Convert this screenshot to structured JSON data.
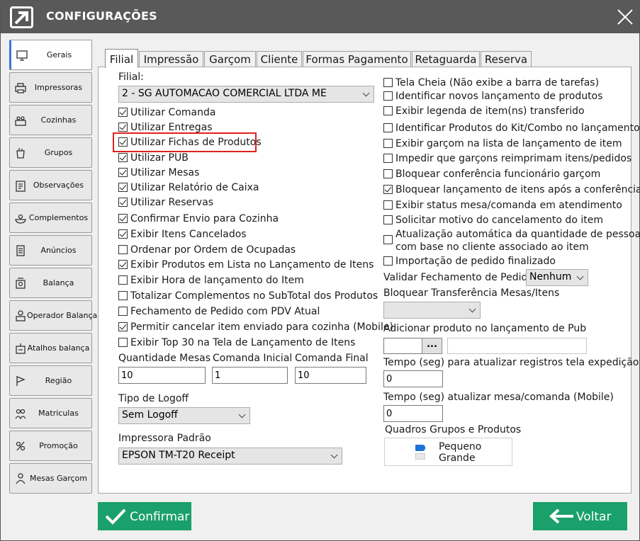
{
  "window": {
    "title": "CONFIGURAÇÕES"
  },
  "colors": {
    "titlebar": "#595959",
    "accent_green": "#1aa06a",
    "highlight": "#e02020",
    "active_tab_marker": "#3c78d8"
  },
  "sidebar": {
    "items": [
      {
        "label": "Gerais",
        "icon": "monitor-icon",
        "active": true
      },
      {
        "label": "Impressoras",
        "icon": "printer-icon"
      },
      {
        "label": "Cozinhas",
        "icon": "kitchen-icon"
      },
      {
        "label": "Grupos",
        "icon": "groups-icon"
      },
      {
        "label": "Observações",
        "icon": "clipboard-icon"
      },
      {
        "label": "Complementos",
        "icon": "dish-icon"
      },
      {
        "label": "Anúncios",
        "icon": "document-icon"
      },
      {
        "label": "Balança",
        "icon": "scale-icon"
      },
      {
        "label": "Operador Balança",
        "icon": "operator-scale-icon"
      },
      {
        "label": "Atalhos balança",
        "icon": "scale-shortcut-icon"
      },
      {
        "label": "Região",
        "icon": "flag-icon"
      },
      {
        "label": "Matriculas",
        "icon": "people-icon"
      },
      {
        "label": "Promoção",
        "icon": "promo-icon"
      },
      {
        "label": "Mesas Garçom",
        "icon": "waiter-icon"
      }
    ]
  },
  "tabs": [
    {
      "label": "Filial",
      "active": true
    },
    {
      "label": "Impressão"
    },
    {
      "label": "Garçom"
    },
    {
      "label": "Cliente"
    },
    {
      "label": "Formas Pagamento"
    },
    {
      "label": "Retaguarda"
    },
    {
      "label": "Reserva"
    }
  ],
  "left": {
    "filial_label": "Filial:",
    "filial_value": "2 - SG AUTOMACAO COMERCIAL LTDA ME",
    "checks": [
      {
        "label": "Utilizar Comanda",
        "checked": true
      },
      {
        "label": "Utilizar Entregas",
        "checked": true
      },
      {
        "label": "Utilizar Fichas de Produtos",
        "checked": true
      },
      {
        "label": "Utilizar PUB",
        "checked": true
      },
      {
        "label": "Utilizar Mesas",
        "checked": true
      },
      {
        "label": "Utilizar Relatório de Caixa",
        "checked": true
      },
      {
        "label": "Utilizar Reservas",
        "checked": true
      },
      {
        "label": "Confirmar Envio para Cozinha",
        "checked": true
      },
      {
        "label": "Exibir Itens Cancelados",
        "checked": true
      },
      {
        "label": "Ordenar por Ordem de Ocupadas",
        "checked": false
      },
      {
        "label": "Exibir Produtos em Lista no Lançamento de Itens",
        "checked": true
      },
      {
        "label": "Exibir Hora de lançamento do Item",
        "checked": false
      },
      {
        "label": "Totalizar Complementos no SubTotal dos Produtos",
        "checked": false
      },
      {
        "label": "Fechamento de Pedido com PDV Atual",
        "checked": false
      },
      {
        "label": "Permitir cancelar item enviado para cozinha (Mobile)",
        "checked": true
      },
      {
        "label": "Exibir Top 30 na Tela de Lançamento de Itens",
        "checked": false
      }
    ],
    "qtd_mesas_label": "Quantidade Mesas",
    "qtd_mesas_value": "10",
    "comanda_inicial_label": "Comanda Inicial",
    "comanda_inicial_value": "1",
    "comanda_final_label": "Comanda Final",
    "comanda_final_value": "10",
    "logoff_label": "Tipo de Logoff",
    "logoff_value": "Sem Logoff",
    "impressora_label": "Impressora Padrão",
    "impressora_value": "EPSON TM-T20 Receipt"
  },
  "right": {
    "checks": [
      {
        "label": "Tela Cheia (Não exibe a barra de tarefas)",
        "checked": false
      },
      {
        "label": "Identificar novos lançamento de produtos",
        "checked": false
      },
      {
        "label": "Exibir legenda de item(ns) transferido",
        "checked": false
      },
      {
        "label": "Identificar Produtos do Kit/Combo no lançamento",
        "checked": false
      },
      {
        "label": "Exibir garçom na lista de lançamento de item",
        "checked": false
      },
      {
        "label": "Impedir que garçons reimprimam itens/pedidos",
        "checked": false
      },
      {
        "label": "Bloquear conferência funcionário garçom",
        "checked": false
      },
      {
        "label": "Bloquear lançamento de itens após a conferência",
        "checked": true
      },
      {
        "label": "Exibir status mesa/comanda em atendimento",
        "checked": false
      },
      {
        "label": "Solicitar motivo do cancelamento do item",
        "checked": false
      },
      {
        "label": "Atualização automática da quantidade de pessoas",
        "label2": "com base no cliente associado ao item",
        "checked": false
      },
      {
        "label": "Importação de pedido finalizado",
        "checked": false
      }
    ],
    "validar_label": "Validar Fechamento de Pedido",
    "validar_value": "Nenhum",
    "bloquear_transf_label": "Bloquear Transferência Mesas/Itens",
    "bloquear_transf_value": "",
    "adicionar_pub_label": "Adicionar produto no lançamento de Pub",
    "adicionar_pub_button": "...",
    "tempo_expedicao_label": "Tempo (seg) para atualizar registros tela expedição",
    "tempo_expedicao_value": "0",
    "tempo_mobile_label": "Tempo (seg) atualizar mesa/comanda (Mobile)",
    "tempo_mobile_value": "0",
    "quadros_label": "Quadros Grupos e Produtos",
    "quadros_option1": "Pequeno",
    "quadros_option2": "Grande"
  },
  "footer": {
    "confirm_label": "Confirmar",
    "back_label": "Voltar"
  }
}
